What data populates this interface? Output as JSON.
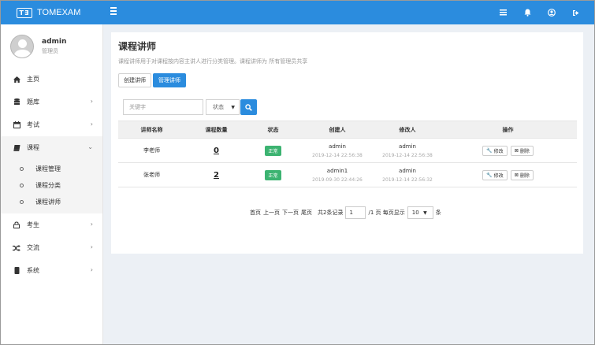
{
  "header": {
    "logo_mark": "T∃",
    "brand": "TOMEXAM",
    "icons": [
      "menu-icon",
      "list-icon",
      "bell-icon",
      "user-icon",
      "logout-icon"
    ]
  },
  "user": {
    "name": "admin",
    "role": "管理员"
  },
  "sidebar": {
    "items": [
      {
        "label": "主页",
        "icon": "home-icon"
      },
      {
        "label": "题库",
        "icon": "database-icon"
      },
      {
        "label": "考试",
        "icon": "calendar-icon"
      },
      {
        "label": "课程",
        "icon": "book-icon"
      },
      {
        "label": "考生",
        "icon": "lock-icon"
      },
      {
        "label": "交流",
        "icon": "random-icon"
      },
      {
        "label": "系统",
        "icon": "book-icon"
      }
    ],
    "sub_items": [
      {
        "label": "课程管理"
      },
      {
        "label": "课程分类"
      },
      {
        "label": "课程讲师"
      }
    ]
  },
  "main": {
    "title": "课程讲师",
    "description": "课程讲师用于对课程按内容主讲人进行分类管理。课程讲师为 所有管理员共享",
    "tabs": [
      "创建讲师",
      "管理讲师"
    ],
    "search_placeholder": "关键字",
    "status_label": "状态",
    "table": {
      "headers": [
        "讲师名称",
        "课程数量",
        "状态",
        "创建人",
        "修改人",
        "操作"
      ],
      "rows": [
        {
          "name": "李老师",
          "count": "0",
          "status": "正常",
          "creator": "admin",
          "created": "2019-12-14 22:56:38",
          "modifier": "admin",
          "modified": "2019-12-14 22:56:38",
          "edit": "修改",
          "delete": "删除"
        },
        {
          "name": "张老师",
          "count": "2",
          "status": "正常",
          "creator": "admin1",
          "created": "2019-09-30 22:44:26",
          "modifier": "admin",
          "modified": "2019-12-14 22:56:32",
          "edit": "修改",
          "delete": "删除"
        }
      ]
    },
    "pager": {
      "first": "首页",
      "prev": "上一页",
      "next": "下一页",
      "last": "尾页",
      "total": "共2条记录",
      "page": "1",
      "page_total": "/1 页 每页显示",
      "size": "10",
      "unit": "条"
    }
  },
  "colors": {
    "primary": "#2b8cde",
    "success": "#3cb371",
    "background": "#ecf0f5"
  }
}
